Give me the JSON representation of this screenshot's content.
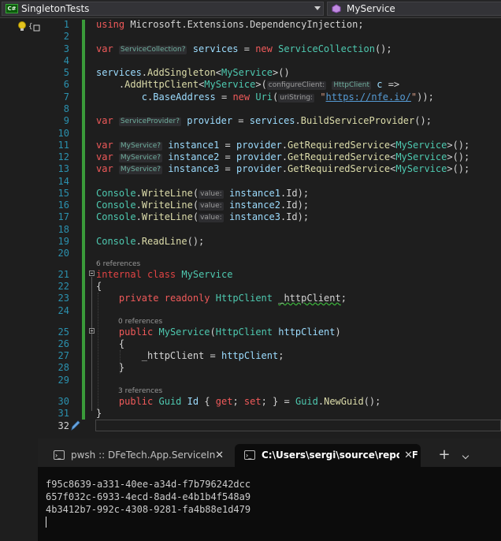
{
  "nav": {
    "project": "SingletonTests",
    "member": "MyService"
  },
  "code": {
    "line_numbers": [
      "1",
      "2",
      "3",
      "4",
      "5",
      "6",
      "7",
      "8",
      "9",
      "10",
      "11",
      "12",
      "13",
      "14",
      "15",
      "16",
      "17",
      "18",
      "19",
      "20",
      "21",
      "22",
      "23",
      "24",
      "25",
      "26",
      "27",
      "28",
      "29",
      "30",
      "31",
      "32"
    ],
    "references": {
      "class": "6 references",
      "ctor": "0 references",
      "prop": "3 references"
    },
    "tokens": {
      "using": "using",
      "ns": "Microsoft.Extensions.DependencyInjection;",
      "var": "var",
      "new": "new",
      "hint_service_collection": "ServiceCollection?",
      "hint_service_provider": "ServiceProvider?",
      "hint_myservice": "MyService?",
      "services": "services",
      "eq": " = ",
      "ServiceCollection": "ServiceCollection",
      "parens_semi": "();",
      "dot": ".",
      "AddSingleton": "AddSingleton",
      "lt": "<",
      "gt": ">",
      "MyService": "MyService",
      "call_open": "()",
      "AddHttpClient": "AddHttpClient",
      "paren_open": "(",
      "hint_configure": "configureClient:",
      "HttpClient": "HttpClient",
      "c": "c",
      "arrow": " =>",
      "BaseAddress": "BaseAddress",
      "Uri": "Uri",
      "hint_uri": "uriString:",
      "quote": "\"",
      "url": "https://nfe.io/",
      "close_uri": "));",
      "provider": "provider",
      "BuildServiceProvider": "BuildServiceProvider",
      "instance1": "instance1",
      "instance2": "instance2",
      "instance3": "instance3",
      "GetRequiredService": "GetRequiredService",
      "generic_close": ">();",
      "Console": "Console",
      "WriteLine": "WriteLine",
      "hint_value": "value:",
      "Id_close": ".Id);",
      "ReadLine": "ReadLine",
      "readline_args": "();",
      "internal": "internal",
      "class": "class",
      "open_brace": "{",
      "close_brace": "}",
      "private": "private",
      "readonly": "readonly",
      "field": "_httpClient",
      "semi": ";",
      "public": "public",
      "httpClient_param": "httpClient",
      "close_paren": ")",
      "Guid": "Guid",
      "Id": "Id",
      "get": "get",
      "set": "set",
      "NewGuid": "NewGuid",
      "prop_open": " { ",
      "prop_mid": "; ",
      "prop_end": "; } = "
    }
  },
  "terminal": {
    "tabs": [
      {
        "label": "pwsh :: DFeTech.App.ServiceIn",
        "close": "✕"
      },
      {
        "label": "C:\\Users\\sergi\\source\\repos\\F",
        "close": "✕"
      }
    ],
    "new_tab": "+",
    "output": [
      "f95c8639-a331-40ee-a34d-f7b796242dcc",
      "657f032c-6933-4ecd-8ad4-e4b1b4f548a9",
      "4b3412b7-992c-4308-9281-fa4b88e1d479"
    ]
  }
}
